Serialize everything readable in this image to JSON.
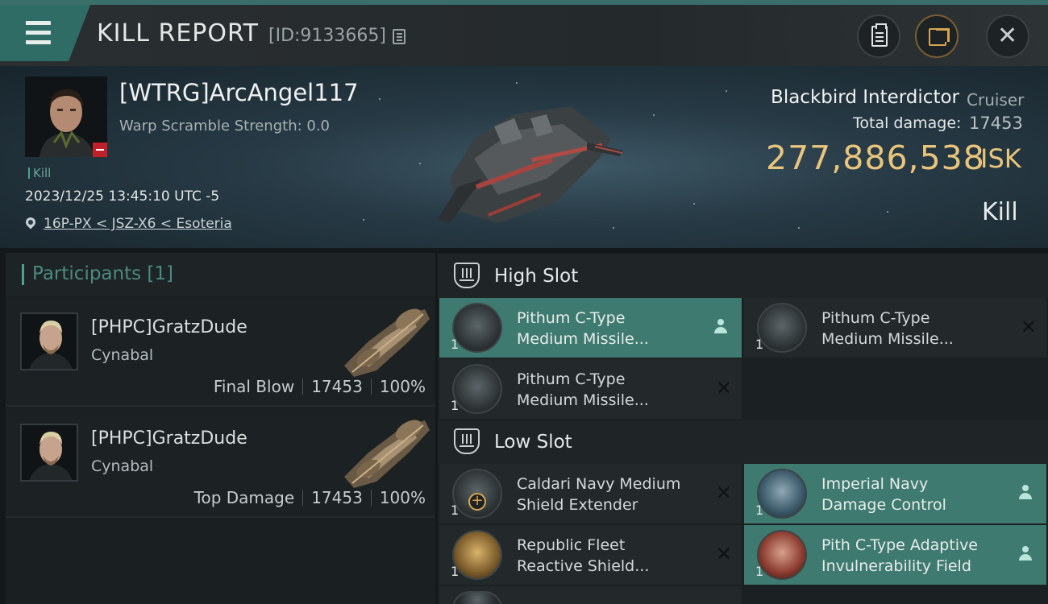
{
  "header": {
    "title": "KILL REPORT",
    "report_id": "[ID:9133665]",
    "icons": [
      "menu-icon",
      "copy-icon",
      "clipboard-icon",
      "share-icon",
      "close-icon"
    ]
  },
  "victim": {
    "name": "[WTRG]ArcAngel117",
    "warp": "Warp Scramble Strength: 0.0",
    "kill_tag": "Kill",
    "date": "2023/12/25 13:45:10 UTC -5",
    "location": "16P-PX < JSZ-X6 < Esoteria",
    "ship_name": "Blackbird Interdictor",
    "ship_class": "Cruiser",
    "damage_label": "Total damage:",
    "damage_value": "17453",
    "isk_value": "277,886,538",
    "isk_unit": "ISK",
    "result": "Kill"
  },
  "participants": {
    "title": "Participants",
    "count": "[1]",
    "items": [
      {
        "name": "[PHPC]GratzDude",
        "ship": "Cynabal",
        "role": "Final Blow",
        "damage": "17453",
        "percent": "100%"
      },
      {
        "name": "[PHPC]GratzDude",
        "ship": "Cynabal",
        "role": "Top Damage",
        "damage": "17453",
        "percent": "100%"
      }
    ]
  },
  "slots": {
    "high": {
      "title": "High Slot",
      "modules": [
        {
          "name_line1": "Pithum C-Type",
          "name_line2": "Medium Missile...",
          "qty": "1",
          "state": "dropped"
        },
        {
          "name_line1": "Pithum C-Type",
          "name_line2": "Medium Missile...",
          "qty": "1",
          "state": "destroyed"
        },
        {
          "name_line1": "Pithum C-Type",
          "name_line2": "Medium Missile...",
          "qty": "1",
          "state": "destroyed"
        }
      ]
    },
    "low": {
      "title": "Low Slot",
      "modules": [
        {
          "name_line1": "Caldari Navy Medium",
          "name_line2": "Shield Extender",
          "qty": "1",
          "state": "destroyed"
        },
        {
          "name_line1": "Imperial Navy",
          "name_line2": "Damage Control",
          "qty": "1",
          "state": "dropped"
        },
        {
          "name_line1": "Republic Fleet",
          "name_line2": "Reactive Shield...",
          "qty": "1",
          "state": "destroyed"
        },
        {
          "name_line1": "Pith C-Type Adaptive",
          "name_line2": "Invulnerability Field",
          "qty": "1",
          "state": "dropped"
        }
      ]
    }
  },
  "colors": {
    "accent": "#3f7a70",
    "isk": "#e9c57c",
    "background": "#14181a"
  }
}
